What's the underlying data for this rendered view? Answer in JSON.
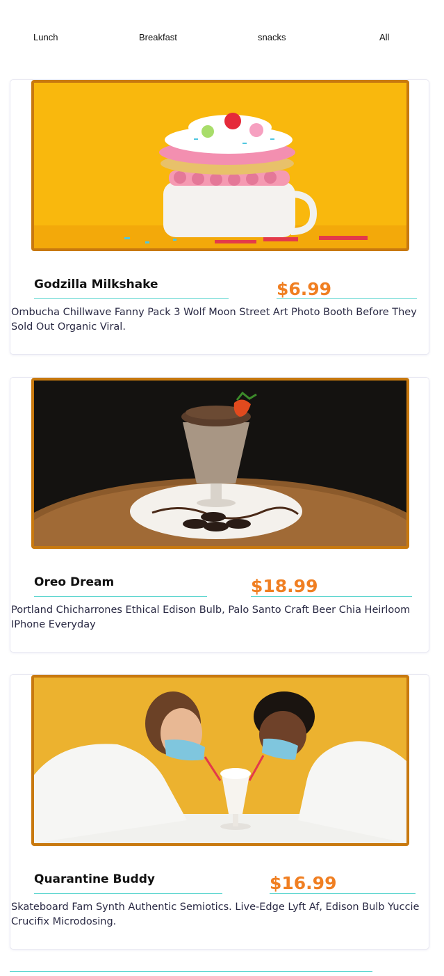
{
  "tabs": [
    "Lunch",
    "Breakfast",
    "snacks",
    "All"
  ],
  "colors": {
    "frame": "#c8790f",
    "price": "#f07f22",
    "underline": "#5fd6d0"
  },
  "items": [
    {
      "title": "Godzilla Milkshake",
      "price": "$6.99",
      "description": "Ombucha Chillwave Fanny Pack 3 Wolf Moon Street Art Photo Booth Before They Sold Out Organic Viral.",
      "image": "milkshake-photo"
    },
    {
      "title": "Oreo Dream",
      "price": "$18.99",
      "description": "Portland Chicharrones Ethical Edison Bulb, Palo Santo Craft Beer Chia Heirloom IPhone Everyday",
      "image": "oreo-shake-photo"
    },
    {
      "title": "Quarantine Buddy",
      "price": "$16.99",
      "description": "Skateboard Fam Synth Authentic Semiotics. Live-Edge Lyft Af, Edison Bulb Yuccie Crucifix Microdosing.",
      "image": "couple-sharing-shake-photo"
    }
  ]
}
